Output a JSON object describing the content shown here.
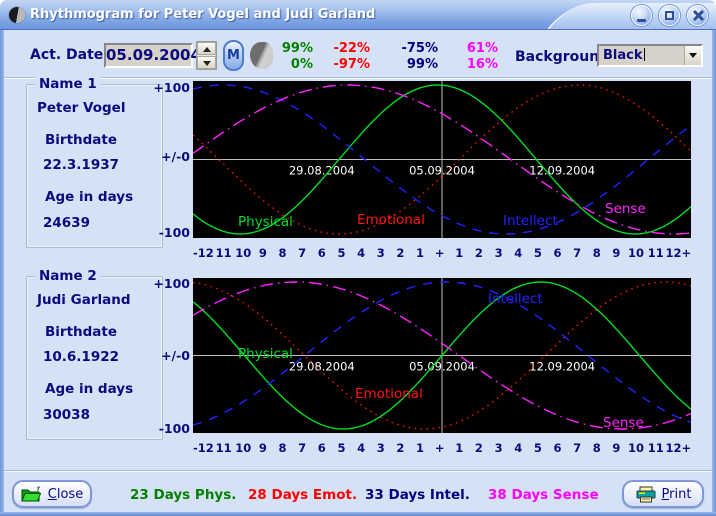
{
  "window": {
    "title": "Rhythmogram for Peter Vogel and Judi Garland",
    "app_icon": "moon-phase"
  },
  "toolbar": {
    "act_date_label": "Act. Date",
    "act_date_value": "05.09.2004",
    "m_button_label": "M",
    "moon_icon": "moon-phase-indicator",
    "background_label": "Background",
    "background_value": "Black",
    "percent_rows": [
      [
        {
          "text": "99%",
          "color": "#008000"
        },
        {
          "text": "-22%",
          "color": "#ff0000"
        },
        {
          "text": "-75%",
          "color": "#000080"
        },
        {
          "text": "61%",
          "color": "#ff00ff"
        }
      ],
      [
        {
          "text": "0%",
          "color": "#008000"
        },
        {
          "text": "-97%",
          "color": "#ff0000"
        },
        {
          "text": "99%",
          "color": "#000080"
        },
        {
          "text": "16%",
          "color": "#ff00ff"
        }
      ]
    ]
  },
  "persons": [
    {
      "group_label": "Name 1",
      "name": "Peter Vogel",
      "birthdate_label": "Birthdate",
      "birthdate": "22.3.1937",
      "age_label": "Age in days",
      "age_days_text": "24639"
    },
    {
      "group_label": "Name 2",
      "name": "Judi Garland",
      "birthdate_label": "Birthdate",
      "birthdate": "10.6.1922",
      "age_label": "Age in days",
      "age_days_text": "30038"
    }
  ],
  "chart_data": {
    "type": "line",
    "description": "Biorhythm sine curves value = sin(2*PI*(age_days+d)/period_days), d = days from actual date",
    "background": "#000000",
    "grid_color": "#bebebe",
    "date_label_color": "#ffffff",
    "x_axis": {
      "span_days": [
        -14.5,
        14.5
      ],
      "labels": [
        "-12",
        "11",
        "10",
        "9",
        "8",
        "7",
        "6",
        "5",
        "4",
        "3",
        "2",
        "1",
        "+",
        "1",
        "2",
        "3",
        "4",
        "5",
        "6",
        "7",
        "8",
        "9",
        "10",
        "11",
        "12+"
      ]
    },
    "y_axis": {
      "labels": [
        "+100",
        "+/-0",
        "-100"
      ],
      "range": [
        -100,
        100
      ]
    },
    "date_markers": [
      {
        "label": "29.08.2004",
        "day": -7
      },
      {
        "label": "05.09.2004",
        "day": 0
      },
      {
        "label": "12.09.2004",
        "day": 7
      }
    ],
    "dash_patterns": {
      "solid": "",
      "dotted": "1.5 4.5",
      "dashed": "9 8",
      "dashdot": "13 5 1.5 5"
    },
    "series_defs": [
      {
        "name": "Physical",
        "color": "#00dd22",
        "period_days": 23,
        "dash": "solid"
      },
      {
        "name": "Emotional",
        "color": "#ff1414",
        "period_days": 28,
        "dash": "dotted"
      },
      {
        "name": "Intellect",
        "color": "#2222ff",
        "period_days": 33,
        "dash": "dashed"
      },
      {
        "name": "Sense",
        "color": "#ff22ff",
        "period_days": 38,
        "dash": "dashdot"
      }
    ],
    "charts": [
      {
        "person": "Peter Vogel",
        "age_days": 24639,
        "values_on_act_date": {
          "Physical": "99%",
          "Emotional": "-22%",
          "Intellect": "-75%",
          "Sense": "61%"
        },
        "label_positions": {
          "Physical": [
            45,
            145
          ],
          "Emotional": [
            164,
            143
          ],
          "Intellect": [
            310,
            144
          ],
          "Sense": [
            412,
            132
          ]
        }
      },
      {
        "person": "Judi Garland",
        "age_days": 30038,
        "values_on_act_date": {
          "Physical": "0%",
          "Emotional": "-97%",
          "Intellect": "99%",
          "Sense": "16%"
        },
        "label_positions": {
          "Physical": [
            45,
            80
          ],
          "Emotional": [
            162,
            120
          ],
          "Intellect": [
            295,
            25
          ],
          "Sense": [
            410,
            149
          ]
        }
      }
    ]
  },
  "statusbar": {
    "close_button_pre": "C",
    "close_button_rest": "lose",
    "print_button_pre": "P",
    "print_button_rest": "rint",
    "cycle_info": [
      {
        "text": "23 Days Phys.",
        "color": "#008000"
      },
      {
        "text": "28 Days Emot.",
        "color": "#ff0000"
      },
      {
        "text": "33 Days Intel.",
        "color": "#000080"
      },
      {
        "text": "38 Days Sense",
        "color": "#ff00ff"
      }
    ]
  }
}
